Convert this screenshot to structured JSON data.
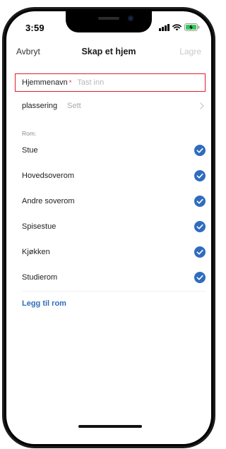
{
  "status_bar": {
    "time": "3:59"
  },
  "nav": {
    "cancel_label": "Avbryt",
    "title": "Skap et hjem",
    "save_label": "Lagre"
  },
  "form": {
    "name_label": "Hjemmenavn",
    "required_marker": "*",
    "name_placeholder": "Tast inn",
    "name_value": "",
    "location_label": "plassering",
    "location_value": "Sett"
  },
  "rooms": {
    "header": "Rom:",
    "items": [
      {
        "label": "Stue",
        "checked": true
      },
      {
        "label": "Hovedsoverom",
        "checked": true
      },
      {
        "label": "Andre soverom",
        "checked": true
      },
      {
        "label": "Spisestue",
        "checked": true
      },
      {
        "label": "Kjøkken",
        "checked": true
      },
      {
        "label": "Studierom",
        "checked": true
      }
    ],
    "add_label": "Legg til rom"
  },
  "colors": {
    "accent": "#2f6cbf",
    "error_border": "#e01e2b",
    "disabled_text": "#c9c9c9",
    "check_fill": "#2f6cbf"
  },
  "icons": {
    "check": "check-circle-icon",
    "chevron": "chevron-right-icon",
    "signal": "cellular-signal-icon",
    "wifi": "wifi-icon",
    "battery": "battery-charging-icon"
  }
}
